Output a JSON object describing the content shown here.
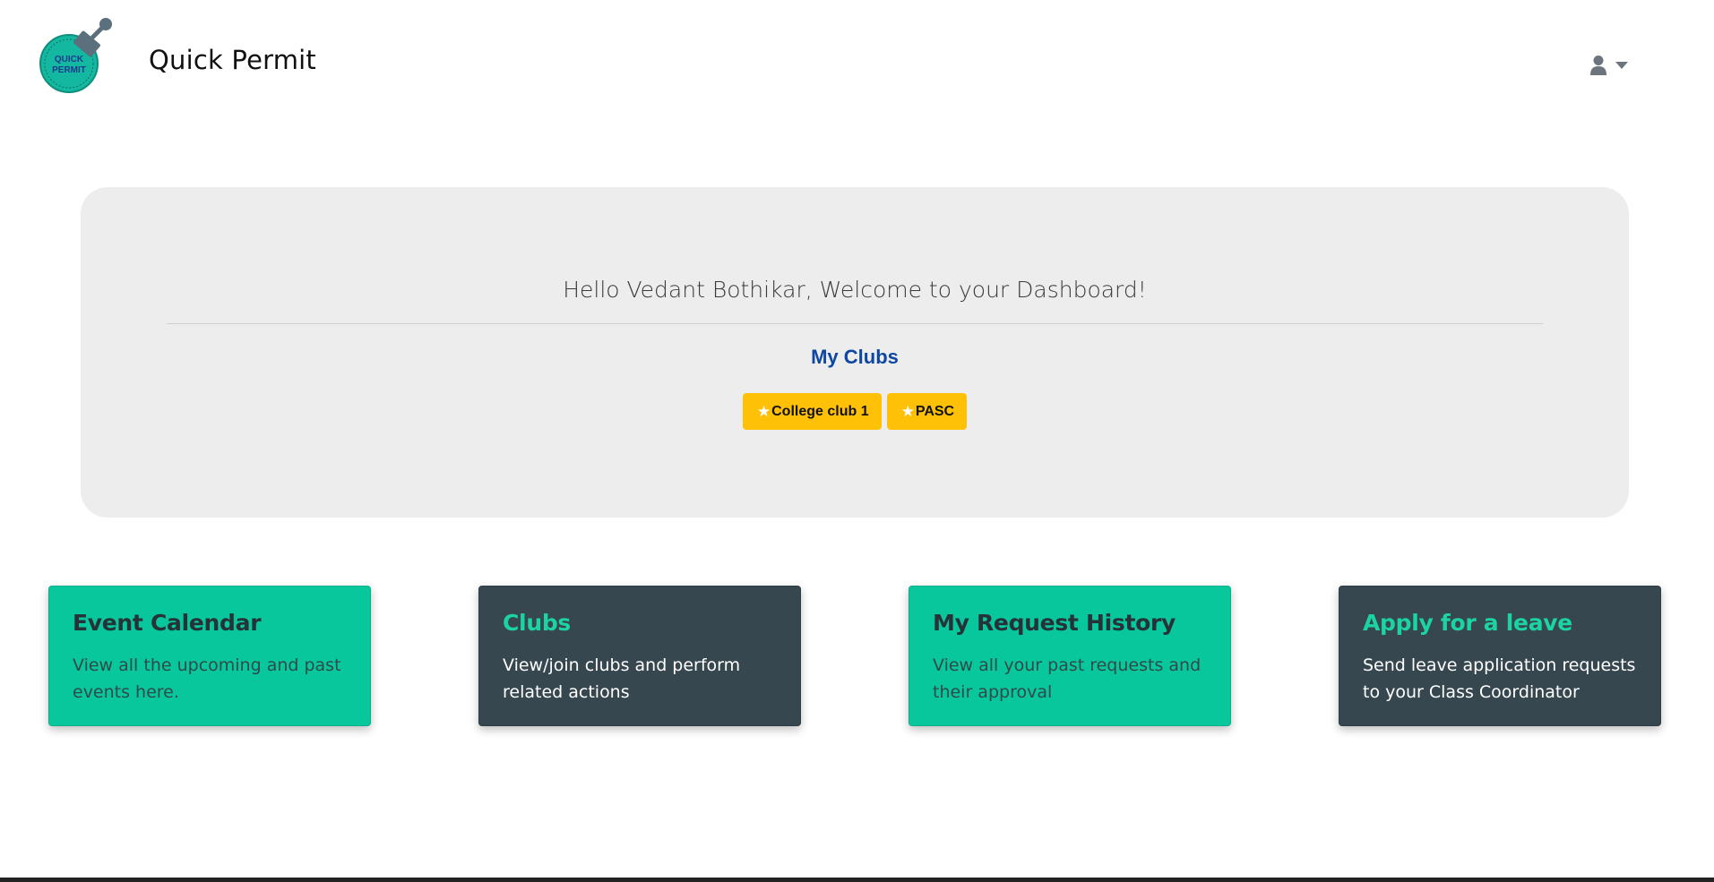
{
  "header": {
    "brand_title": "Quick Permit",
    "logo_text_line1": "QUICK",
    "logo_text_line2": "PERMIT",
    "user_icon": "user-icon",
    "dropdown_icon": "caret-down-icon"
  },
  "dashboard": {
    "welcome_text": "Hello Vedant Bothikar, Welcome to your Dashboard!",
    "clubs_heading": "My Clubs",
    "clubs": [
      {
        "label": "College club 1",
        "icon": "star-icon"
      },
      {
        "label": "PASC",
        "icon": "star-icon"
      }
    ]
  },
  "cards": [
    {
      "title": "Event Calendar",
      "text": "View all the upcoming and past events here."
    },
    {
      "title": "Clubs",
      "text": "View/join clubs and perform related actions"
    },
    {
      "title": "My Request History",
      "text": "View all your past requests and their approval"
    },
    {
      "title": "Apply for a leave",
      "text": "Send leave application requests to your Class Coordinator"
    }
  ],
  "colors": {
    "card_green": "#08c79c",
    "card_dark": "#37474f",
    "badge_yellow": "#ffc107",
    "heading_blue": "#0d47a1"
  }
}
